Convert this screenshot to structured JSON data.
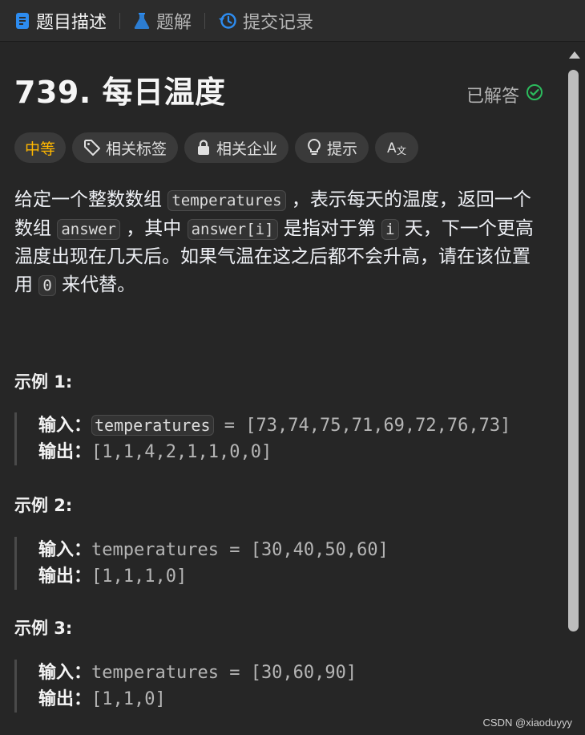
{
  "tabs": {
    "description": "题目描述",
    "solutions": "题解",
    "submissions": "提交记录"
  },
  "problem": {
    "title": "739. 每日温度",
    "status": "已解答"
  },
  "tags": {
    "difficulty": "中等",
    "related_tags": "相关标签",
    "related_companies": "相关企业",
    "hint": "提示"
  },
  "description": {
    "p1": "给定一个整数数组",
    "code1": "temperatures",
    "p2": "，表示每天的温度，返回一个数组",
    "code2": "answer",
    "p3": "，其中",
    "code3": "answer[i]",
    "p4": "是指对于第",
    "code4": "i",
    "p5": "天，下一个更高温度出现在几天后。如果气温在这之后都不会升高，请在该位置用",
    "code5": "0",
    "p6": "来代替。"
  },
  "examples": [
    {
      "title": "示例 1:",
      "input_label": "输入：",
      "input_var": "temperatures",
      "input_rest": " = [73,74,75,71,69,72,76,73]",
      "output_label": "输出：",
      "output": "[1,1,4,2,1,1,0,0]"
    },
    {
      "title": "示例 2:",
      "input_label": "输入：",
      "input": "temperatures = [30,40,50,60]",
      "output_label": "输出：",
      "output": "[1,1,1,0]"
    },
    {
      "title": "示例 3:",
      "input_label": "输入：",
      "input": "temperatures = [30,60,90]",
      "output_label": "输出：",
      "output": "[1,1,0]"
    }
  ],
  "watermark": "CSDN @xiaoduyyy",
  "colors": {
    "difficulty_medium": "#ffb700",
    "solved_check": "#2cbb5d",
    "description_tab_icon": "#2d8cf0",
    "solutions_tab_icon": "#2d8cf0",
    "submissions_tab_icon": "#2d8cf0"
  }
}
